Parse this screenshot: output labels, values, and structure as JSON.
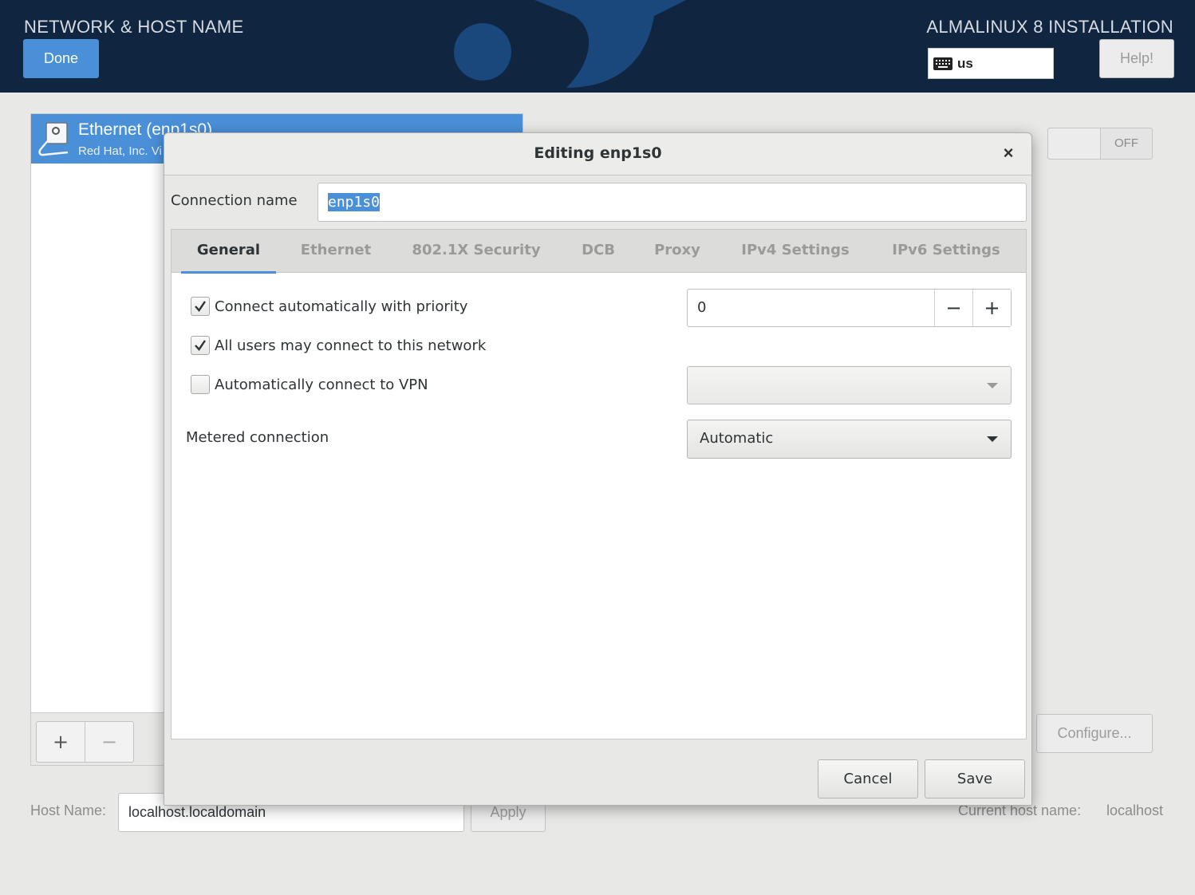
{
  "header": {
    "page_title": "NETWORK & HOST NAME",
    "product_title": "ALMALINUX 8 INSTALLATION",
    "done_label": "Done",
    "keyboard_layout": "us",
    "help_label": "Help!"
  },
  "devices": {
    "selected": {
      "name": "Ethernet (enp1s0)",
      "vendor": "Red Hat, Inc. Vi"
    },
    "add_label": "+",
    "remove_label": "−"
  },
  "device_panel": {
    "toggle_state": "OFF",
    "configure_label": "Configure..."
  },
  "hostname": {
    "label": "Host Name:",
    "value": "localhost.localdomain",
    "apply_label": "Apply",
    "current_label": "Current host name:",
    "current_value": "localhost"
  },
  "dialog": {
    "title": "Editing enp1s0",
    "close_glyph": "×",
    "connection_name_label": "Connection name",
    "connection_name_value": "enp1s0",
    "tabs": [
      {
        "label": "General",
        "active": true
      },
      {
        "label": "Ethernet",
        "active": false
      },
      {
        "label": "802.1X Security",
        "active": false
      },
      {
        "label": "DCB",
        "active": false
      },
      {
        "label": "Proxy",
        "active": false
      },
      {
        "label": "IPv4 Settings",
        "active": false
      },
      {
        "label": "IPv6 Settings",
        "active": false
      }
    ],
    "general": {
      "auto_connect": {
        "label": "Connect automatically with priority",
        "checked": true
      },
      "priority_value": "0",
      "priority_minus": "−",
      "priority_plus": "+",
      "all_users": {
        "label": "All users may connect to this network",
        "checked": true
      },
      "auto_vpn": {
        "label": "Automatically connect to VPN",
        "checked": false
      },
      "vpn_selected": "",
      "metered_label": "Metered connection",
      "metered_value": "Automatic"
    },
    "cancel_label": "Cancel",
    "save_label": "Save"
  },
  "colors": {
    "header_bg": "#0f2540",
    "accent": "#4a90d9",
    "window_bg": "#e8e8e7"
  }
}
